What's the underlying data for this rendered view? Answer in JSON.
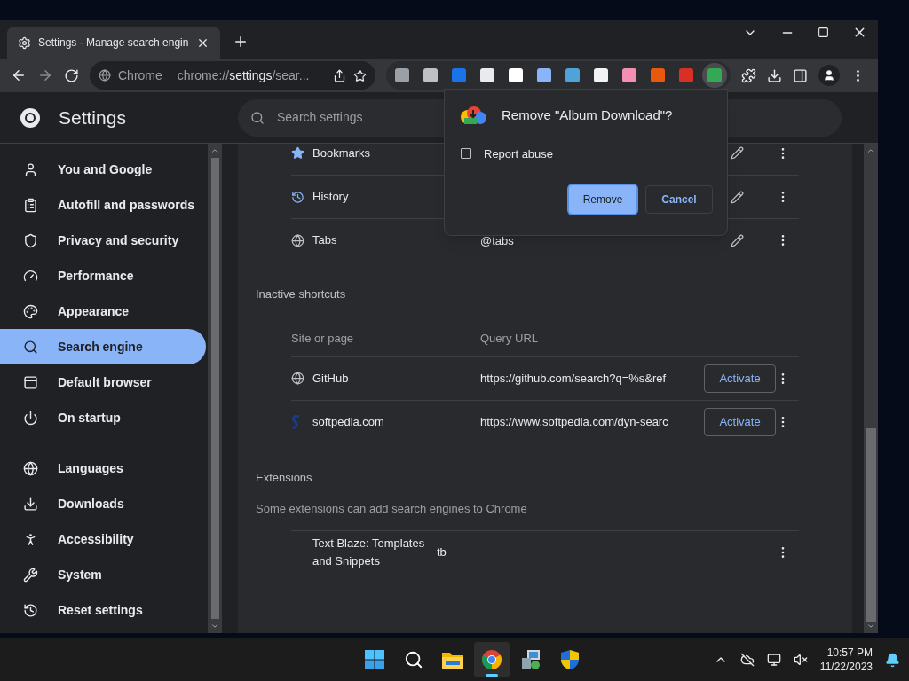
{
  "tab": {
    "title": "Settings - Manage search engin",
    "selected": true
  },
  "toolbar": {
    "site_label": "Chrome",
    "url_prefix": "chrome://",
    "url_bold": "settings",
    "url_suffix": "/sear..."
  },
  "extensions": [
    {
      "color": "#9aa0a6",
      "selected": false
    },
    {
      "color": "#bdc1c6",
      "selected": false
    },
    {
      "color": "#1a73e8",
      "selected": false
    },
    {
      "color": "#e8eaed",
      "selected": false
    },
    {
      "color": "#ffffff",
      "selected": false
    },
    {
      "color": "#8ab4f8",
      "selected": false
    },
    {
      "color": "#4fa3d9",
      "selected": false
    },
    {
      "color": "#f1f3f4",
      "selected": false
    },
    {
      "color": "#f48fb1",
      "selected": false
    },
    {
      "color": "#e8590c",
      "selected": false
    },
    {
      "color": "#d93025",
      "selected": false
    },
    {
      "color": "#34a853",
      "selected": true
    }
  ],
  "header": {
    "title": "Settings",
    "search_placeholder": "Search settings"
  },
  "sidebar": {
    "groups": [
      [
        {
          "label": "You and Google",
          "selected": false
        },
        {
          "label": "Autofill and passwords",
          "selected": false
        },
        {
          "label": "Privacy and security",
          "selected": false
        },
        {
          "label": "Performance",
          "selected": false
        },
        {
          "label": "Appearance",
          "selected": false
        },
        {
          "label": "Search engine",
          "selected": true
        },
        {
          "label": "Default browser",
          "selected": false
        },
        {
          "label": "On startup",
          "selected": false
        }
      ],
      [
        {
          "label": "Languages",
          "selected": false
        },
        {
          "label": "Downloads",
          "selected": false
        },
        {
          "label": "Accessibility",
          "selected": false
        },
        {
          "label": "System",
          "selected": false
        },
        {
          "label": "Reset settings",
          "selected": false
        }
      ]
    ]
  },
  "active_shortcuts": [
    {
      "name": "Bookmarks"
    },
    {
      "name": "History"
    },
    {
      "name": "Tabs",
      "query": "@tabs"
    }
  ],
  "inactive_shortcuts": {
    "title": "Inactive shortcuts",
    "columns": [
      "Site or page",
      "Query URL"
    ],
    "rows": [
      {
        "name": "GitHub",
        "url": "https://github.com/search?q=%s&ref",
        "button": "Activate"
      },
      {
        "name": "softpedia.com",
        "url": "https://www.softpedia.com/dyn-searc",
        "button": "Activate"
      }
    ]
  },
  "extensions_section": {
    "title": "Extensions",
    "description": "Some extensions can add search engines to Chrome",
    "rows": [
      {
        "name": "Text Blaze: Templates and Snippets",
        "keyword": "tb"
      }
    ]
  },
  "dialog": {
    "title": "Remove \"Album Download\"?",
    "checkbox": {
      "label": "Report abuse",
      "checked": false
    },
    "buttons": [
      {
        "label": "Remove",
        "selected": true
      },
      {
        "label": "Cancel",
        "selected": false
      }
    ]
  },
  "taskbar": {
    "apps": [
      {
        "active": false
      },
      {
        "active": false
      },
      {
        "active": false
      },
      {
        "active": true
      },
      {
        "active": false
      },
      {
        "active": false
      }
    ],
    "time": "10:57 PM",
    "date": "11/22/2023"
  }
}
